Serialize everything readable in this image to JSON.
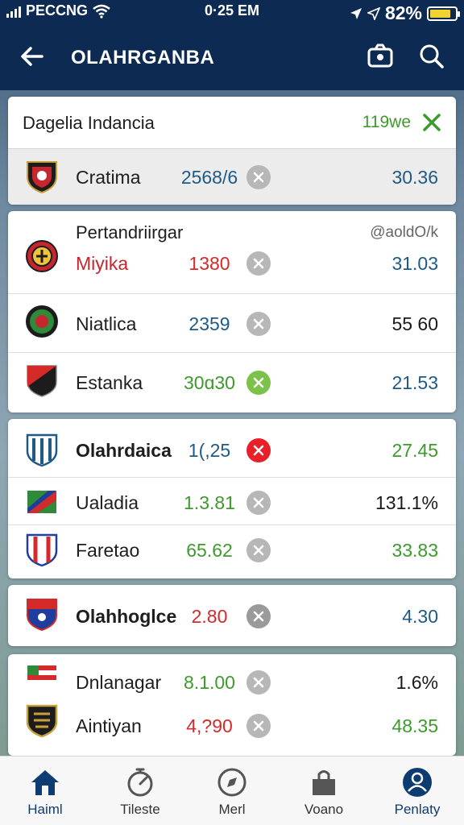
{
  "status_bar": {
    "carrier": "PECCNG",
    "time": "0·25 EM",
    "battery": "82%"
  },
  "app_bar": {
    "title": "OLAHRGANBA",
    "icons": [
      "back-arrow-icon",
      "camera-icon",
      "search-icon"
    ]
  },
  "header_card": {
    "title": "Dagelia Indancia",
    "status": "119we",
    "row": {
      "team": "Cratima",
      "score": "2568/6",
      "right": "30.36"
    }
  },
  "group2": {
    "title": "Pertandriirgar",
    "right_label": "@aoldO/k",
    "rows": [
      {
        "team": "Miyika",
        "score": "1380",
        "right": "31.03"
      },
      {
        "team": "Niatlica",
        "score": "2359",
        "right": "55 60"
      },
      {
        "team": "Estanka",
        "score": "30ɑ30",
        "right": "21.53"
      }
    ]
  },
  "group3": {
    "rows": [
      {
        "team": "Olahrdaica",
        "score": "1(,25",
        "right": "27.45"
      },
      {
        "team": "Ualadia",
        "score": "1.3.81",
        "right": "131.1%"
      },
      {
        "team": "Faretao",
        "score": "65.62",
        "right": "33.83"
      }
    ]
  },
  "group4": {
    "row": {
      "team": "Olahhoglce",
      "score": "2.80",
      "right": "4.30"
    }
  },
  "group5": {
    "rows": [
      {
        "team": "Dnlanagar",
        "score": "8.1.00",
        "right": "1.6%"
      },
      {
        "team": "Aintiyan",
        "score": "4,?90",
        "right": "48.35"
      }
    ]
  },
  "bottom_nav": [
    {
      "label": "Haiml",
      "icon": "home-icon"
    },
    {
      "label": "Tileste",
      "icon": "stopwatch-icon"
    },
    {
      "label": "Merl",
      "icon": "compass-icon"
    },
    {
      "label": "Voano",
      "icon": "bag-icon"
    },
    {
      "label": "Penlaty",
      "icon": "profile-icon"
    }
  ],
  "colors": {
    "navy": "#0d2a52",
    "blue_value": "#1f5a86",
    "green_value": "#3e9a2c",
    "red_value": "#d42a2a"
  }
}
